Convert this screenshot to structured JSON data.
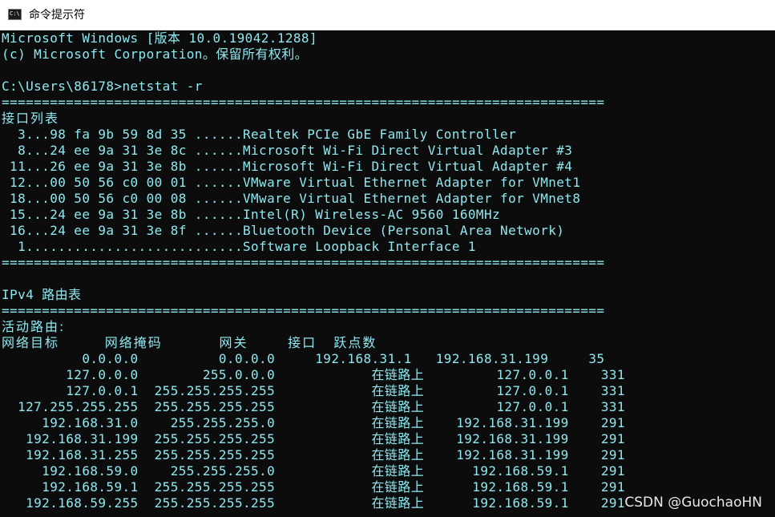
{
  "window": {
    "title": "命令提示符",
    "icon": "console-app-icon"
  },
  "console": {
    "lines": [
      "Microsoft Windows [版本 10.0.19042.1288]",
      "(c) Microsoft Corporation。保留所有权利。",
      "",
      "C:\\Users\\86178>netstat -r",
      "===========================================================================",
      "接口列表",
      "  3...98 fa 9b 59 8d 35 ......Realtek PCIe GbE Family Controller",
      "  8...24 ee 9a 31 3e 8c ......Microsoft Wi-Fi Direct Virtual Adapter #3",
      " 11...26 ee 9a 31 3e 8b ......Microsoft Wi-Fi Direct Virtual Adapter #4",
      " 12...00 50 56 c0 00 01 ......VMware Virtual Ethernet Adapter for VMnet1",
      " 18...00 50 56 c0 00 08 ......VMware Virtual Ethernet Adapter for VMnet8",
      " 15...24 ee 9a 31 3e 8b ......Intel(R) Wireless-AC 9560 160MHz",
      " 16...24 ee 9a 31 3e 8f ......Bluetooth Device (Personal Area Network)",
      "  1...........................Software Loopback Interface 1",
      "===========================================================================",
      "",
      "IPv4 路由表",
      "===========================================================================",
      "活动路由:",
      "网络目标        网络掩码          网关       接口   跃点数",
      "          0.0.0.0          0.0.0.0     192.168.31.1   192.168.31.199     35",
      "        127.0.0.0        255.0.0.0            在链路上         127.0.0.1    331",
      "        127.0.0.1  255.255.255.255            在链路上         127.0.0.1    331",
      "  127.255.255.255  255.255.255.255            在链路上         127.0.0.1    331",
      "     192.168.31.0    255.255.255.0            在链路上    192.168.31.199    291",
      "   192.168.31.199  255.255.255.255            在链路上    192.168.31.199    291",
      "   192.168.31.255  255.255.255.255            在链路上    192.168.31.199    291",
      "     192.168.59.0    255.255.255.0            在链路上      192.168.59.1    291",
      "     192.168.59.1  255.255.255.255            在链路上      192.168.59.1    291",
      "   192.168.59.255  255.255.255.255            在链路上      192.168.59.1    291"
    ]
  },
  "watermark": "CSDN @GuochaoHN"
}
